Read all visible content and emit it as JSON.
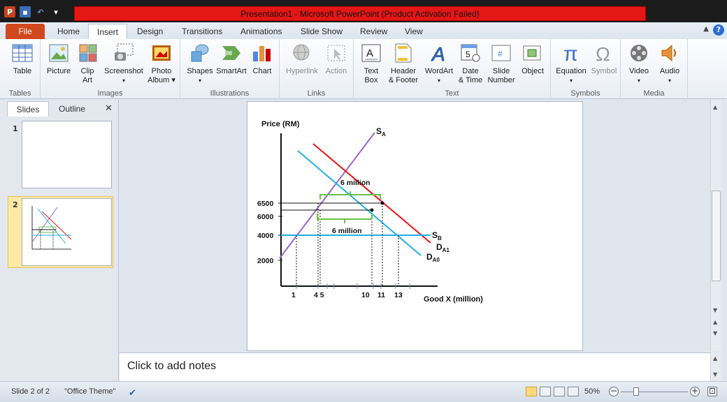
{
  "window": {
    "title": "Presentation1  -  Microsoft PowerPoint (Product Activation Failed)"
  },
  "tabs": [
    "File",
    "Home",
    "Insert",
    "Design",
    "Transitions",
    "Animations",
    "Slide Show",
    "Review",
    "View"
  ],
  "active_tab": "Insert",
  "ribbon": {
    "groups": {
      "tables": "Tables",
      "images": "Images",
      "illustrations": "Illustrations",
      "links": "Links",
      "text": "Text",
      "symbols": "Symbols",
      "media": "Media"
    },
    "buttons": {
      "table": "Table",
      "picture": "Picture",
      "clip_art_1": "Clip",
      "clip_art_2": "Art",
      "screenshot": "Screenshot",
      "photo_album_1": "Photo",
      "photo_album_2": "Album",
      "shapes": "Shapes",
      "smartart": "SmartArt",
      "chart": "Chart",
      "hyperlink": "Hyperlink",
      "action": "Action",
      "text_box_1": "Text",
      "text_box_2": "Box",
      "header_footer_1": "Header",
      "header_footer_2": "& Footer",
      "wordart": "WordArt",
      "date_time_1": "Date",
      "date_time_2": "& Time",
      "slide_number_1": "Slide",
      "slide_number_2": "Number",
      "object": "Object",
      "equation": "Equation",
      "symbol": "Symbol",
      "video": "Video",
      "audio": "Audio"
    }
  },
  "panel": {
    "tab_slides": "Slides",
    "tab_outline": "Outline",
    "slide_numbers": [
      "1",
      "2"
    ]
  },
  "notes_placeholder": "Click to add notes",
  "status": {
    "slide_info": "Slide 2 of 2",
    "theme": "\"Office Theme\"",
    "zoom": "50%"
  },
  "colors": {
    "title_bar_alert": "#e51616",
    "file_tab": "#d2481e",
    "supply_a": "#9966cc",
    "demand_a1": "#ee1111",
    "demand_a0": "#1fb1e6",
    "supply_b": "#1fb1e6",
    "brace": "#6cc04a"
  },
  "chart_data": {
    "type": "line",
    "ylabel": "Price (RM)",
    "xlabel": "Good X (million)",
    "y_ticks": [
      "6500",
      "6000",
      "4000",
      "2000"
    ],
    "x_ticks": [
      "1",
      "4 5",
      "10",
      "11",
      "13"
    ],
    "series": [
      {
        "name": "SA",
        "label_main": "S",
        "label_sub": "A"
      },
      {
        "name": "DA1",
        "label_main": "D",
        "label_sub": "A1"
      },
      {
        "name": "DA0",
        "label_main": "D",
        "label_sub": "A0"
      },
      {
        "name": "SB",
        "label_main": "S",
        "label_sub": "B"
      }
    ],
    "annotations": [
      "6 million",
      "6 million"
    ]
  }
}
